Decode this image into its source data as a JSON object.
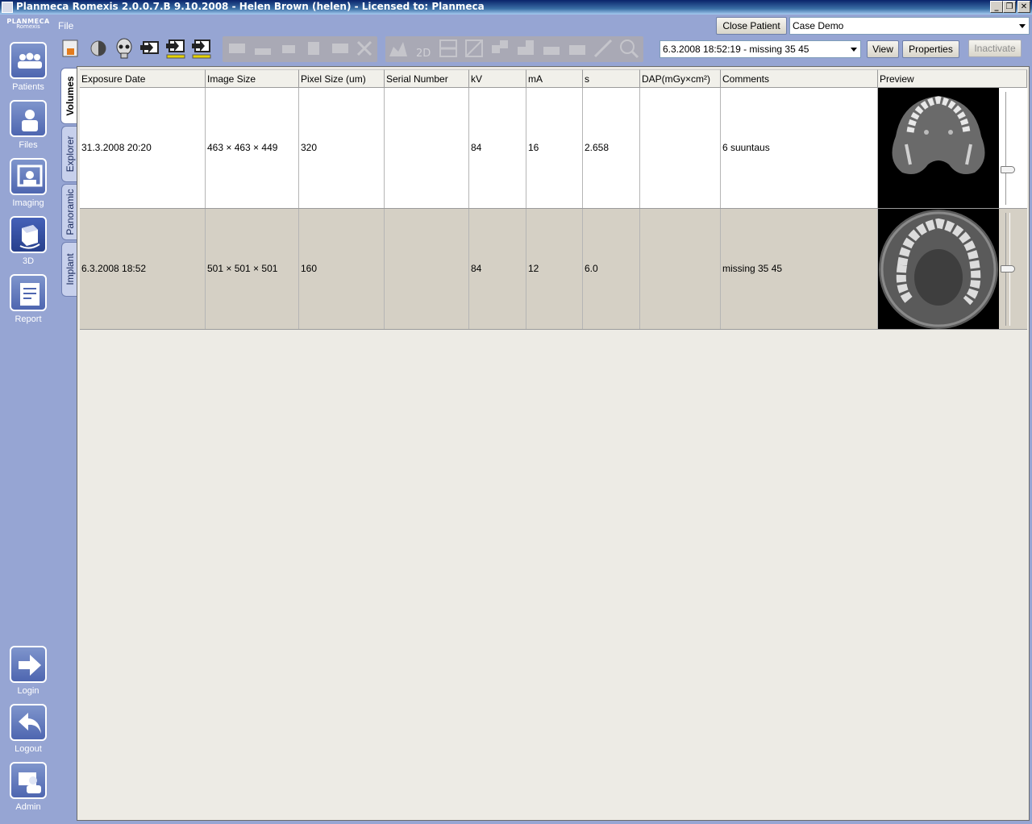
{
  "window": {
    "title": "Planmeca Romexis 2.0.0.7.B  9.10.2008 - Helen Brown (helen) - Licensed to: Planmeca"
  },
  "logo": {
    "line1": "PLANMECA",
    "line2": "Romexis"
  },
  "menu": {
    "file": "File"
  },
  "nav": {
    "items": [
      {
        "label": "Patients",
        "icon": "patients-icon"
      },
      {
        "label": "Files",
        "icon": "files-icon"
      },
      {
        "label": "Imaging",
        "icon": "imaging-icon"
      },
      {
        "label": "3D",
        "icon": "3d-icon",
        "active": true
      },
      {
        "label": "Report",
        "icon": "report-icon"
      }
    ],
    "bottom": [
      {
        "label": "Login",
        "icon": "login-icon"
      },
      {
        "label": "Logout",
        "icon": "logout-icon"
      },
      {
        "label": "Admin",
        "icon": "admin-icon"
      }
    ]
  },
  "top": {
    "close_patient": "Close Patient",
    "patient_select": "Case Demo",
    "volume_select": "6.3.2008 18:52:19 - missing 35 45",
    "view": "View",
    "properties": "Properties",
    "inactivate": "Inactivate"
  },
  "toolbar": {
    "label_2d": "2D"
  },
  "tabs": [
    "Volumes",
    "Explorer",
    "Panoramic",
    "Implant"
  ],
  "table": {
    "columns": [
      "Exposure Date",
      "Image Size",
      "Pixel Size (um)",
      "Serial Number",
      "kV",
      "mA",
      "s",
      "DAP(mGy×cm²)",
      "Comments",
      "Preview"
    ],
    "rows": [
      {
        "date": "31.3.2008 20:20",
        "size": "463 × 463 × 449",
        "pixel": "320",
        "serial": "",
        "kv": "84",
        "ma": "16",
        "s": "2.658",
        "dap": "",
        "comments": "6 suuntaus"
      },
      {
        "date": "6.3.2008 18:52",
        "size": "501 × 501 × 501",
        "pixel": "160",
        "serial": "",
        "kv": "84",
        "ma": "12",
        "s": "6.0",
        "dap": "",
        "comments": "missing 35 45"
      }
    ]
  }
}
